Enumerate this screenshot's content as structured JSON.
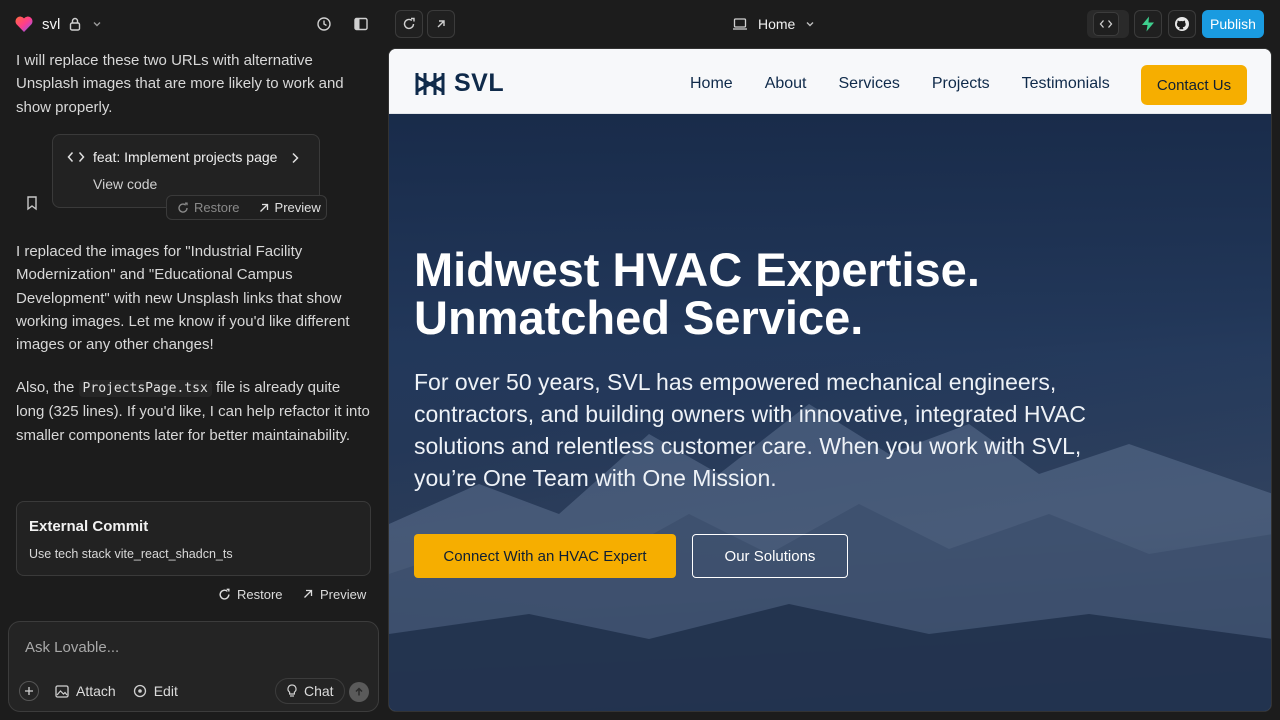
{
  "topbar": {
    "project_name": "svl",
    "page_selector": "Home",
    "publish_label": "Publish"
  },
  "chat": {
    "intro_text": "I will replace these two URLs with alternative Unsplash images that are more likely to work and show properly.",
    "commit_card": {
      "title": "feat: Implement projects page",
      "view_code": "View code",
      "restore": "Restore",
      "preview": "Preview"
    },
    "reply_text": "I replaced the images for \"Industrial Facility Modernization\" and \"Educational Campus Development\" with new Unsplash links that show working images. Let me know if you'd like different images or any other changes!",
    "also_prefix": "Also, the",
    "also_code": "ProjectsPage.tsx",
    "also_suffix": "file is already quite long (325 lines). If you'd like, I can help refactor it into smaller components later for better maintainability.",
    "external_commit": {
      "title": "External Commit",
      "subtitle": "Use tech stack vite_react_shadcn_ts",
      "restore": "Restore",
      "preview": "Preview"
    },
    "composer": {
      "placeholder": "Ask Lovable...",
      "attach": "Attach",
      "edit": "Edit",
      "chat": "Chat"
    }
  },
  "site": {
    "logo_text": "SVL",
    "nav": [
      "Home",
      "About",
      "Services",
      "Projects",
      "Testimonials"
    ],
    "contact_label": "Contact Us",
    "hero_title_1": "Midwest HVAC Expertise.",
    "hero_title_2": "Unmatched Service.",
    "hero_text": "For over 50 years, SVL has empowered mechanical engineers, contractors, and building owners with innovative, integrated HVAC solutions and relentless customer care. When you work with SVL, you’re One Team with One Mission.",
    "cta_primary": "Connect With an HVAC Expert",
    "cta_secondary": "Our Solutions"
  },
  "colors": {
    "accent_yellow": "#f6ae00",
    "publish_blue": "#1a9be0",
    "navy": "#0f2a4a"
  }
}
